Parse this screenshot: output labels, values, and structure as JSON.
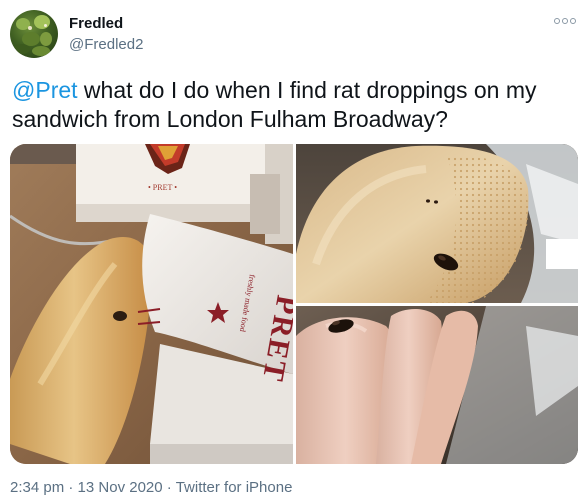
{
  "author": {
    "display_name": "Fredled",
    "handle": "@Fredled2"
  },
  "tweet": {
    "mention": "@Pret",
    "text": " what do I do when I find rat droppings on my sandwich from London Fulham Broadway?"
  },
  "media": {
    "wrapper_text_1": "PRET",
    "wrapper_text_2": "freshly made food",
    "box_text": "• PRET •"
  },
  "meta": {
    "time": "2:34 pm",
    "separator": " · ",
    "date": "13 Nov 2020",
    "source": "Twitter for iPhone"
  },
  "icons": {
    "more": "more-options-icon"
  }
}
